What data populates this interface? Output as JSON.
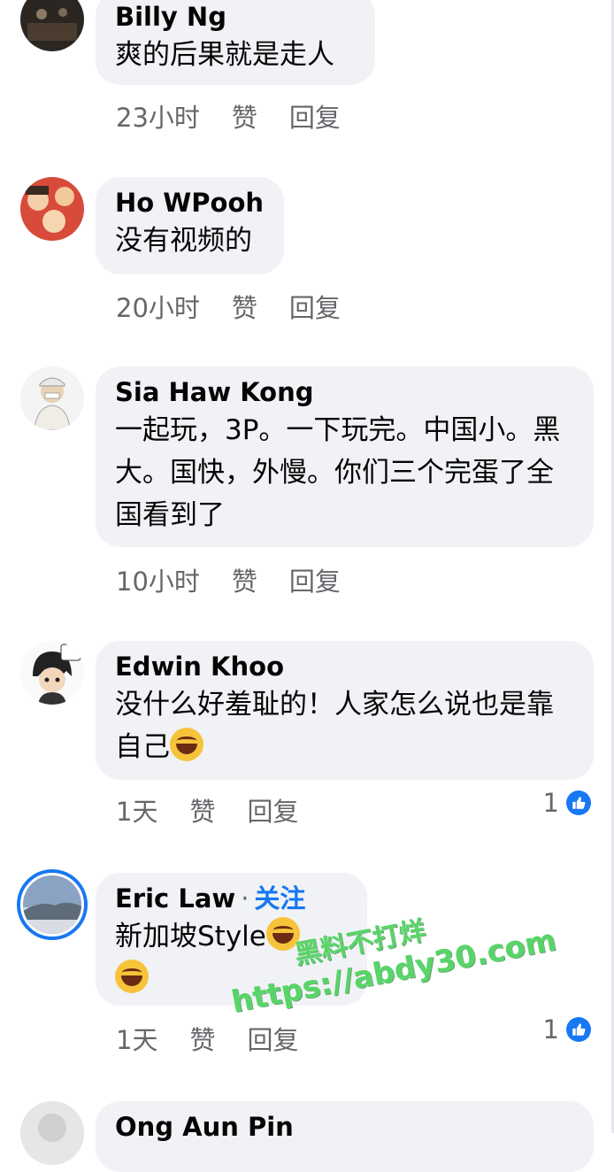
{
  "comments": [
    {
      "name": "Billy Ng",
      "text": "爽的后果就是走人",
      "time": "23小时",
      "like": "赞",
      "reply": "回复"
    },
    {
      "name": "Ho WPooh",
      "text": "没有视频的",
      "time": "20小时",
      "like": "赞",
      "reply": "回复"
    },
    {
      "name": "Sia Haw Kong",
      "text": "一起玩，3P。一下玩完。中国小。黑大。国快，外慢。你们三个完蛋了全国看到了",
      "time": "10小时",
      "like": "赞",
      "reply": "回复"
    },
    {
      "name": "Edwin Khoo",
      "text": "没什么好羞耻的！人家怎么说也是靠自己",
      "time": "1天",
      "like": "赞",
      "reply": "回复",
      "reaction_count": "1"
    },
    {
      "name": "Eric Law",
      "follow": "关注",
      "text": "新加坡Style",
      "time": "1天",
      "like": "赞",
      "reply": "回复",
      "reaction_count": "1"
    },
    {
      "name": "Ong Aun Pin"
    }
  ],
  "watermark": {
    "line1": "黑料不打烊",
    "line2": "https://abdy30.com"
  },
  "colors": {
    "bubble": "#f0f2f5",
    "accent": "#1877f2",
    "meta": "#65676b"
  }
}
